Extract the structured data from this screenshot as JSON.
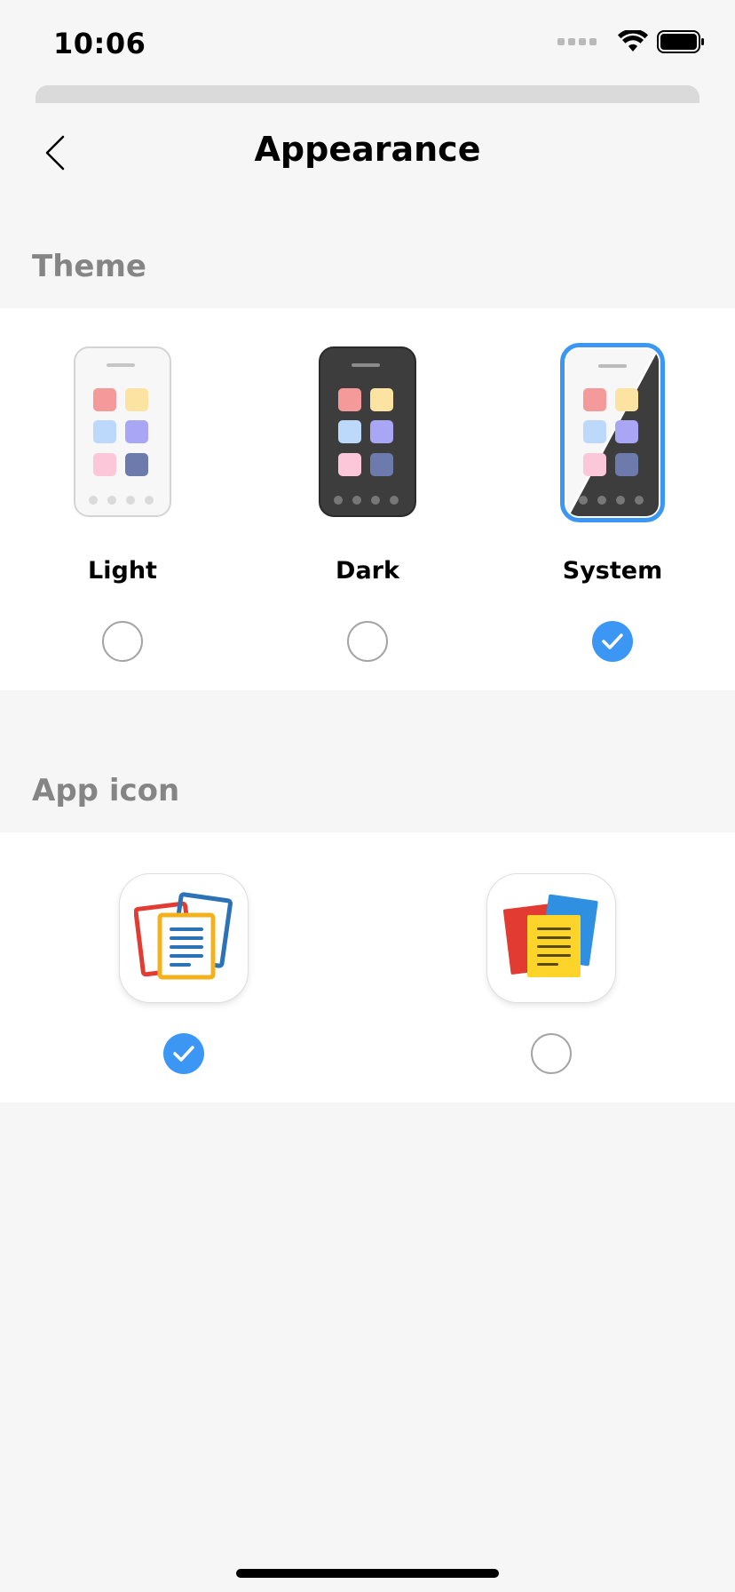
{
  "status_bar": {
    "time": "10:06"
  },
  "nav": {
    "title": "Appearance",
    "back_icon": "chevron-left-icon"
  },
  "theme_section": {
    "header": "Theme",
    "options": [
      {
        "label": "Light",
        "selected": false
      },
      {
        "label": "Dark",
        "selected": false
      },
      {
        "label": "System",
        "selected": true
      }
    ]
  },
  "app_icon_section": {
    "header": "App icon",
    "options": [
      {
        "icon": "notes-blue-icon",
        "selected": true
      },
      {
        "icon": "notes-yellow-icon",
        "selected": false
      }
    ]
  },
  "colors": {
    "accent": "#3b97f3",
    "section_header": "#858585",
    "background": "#f6f6f6"
  }
}
